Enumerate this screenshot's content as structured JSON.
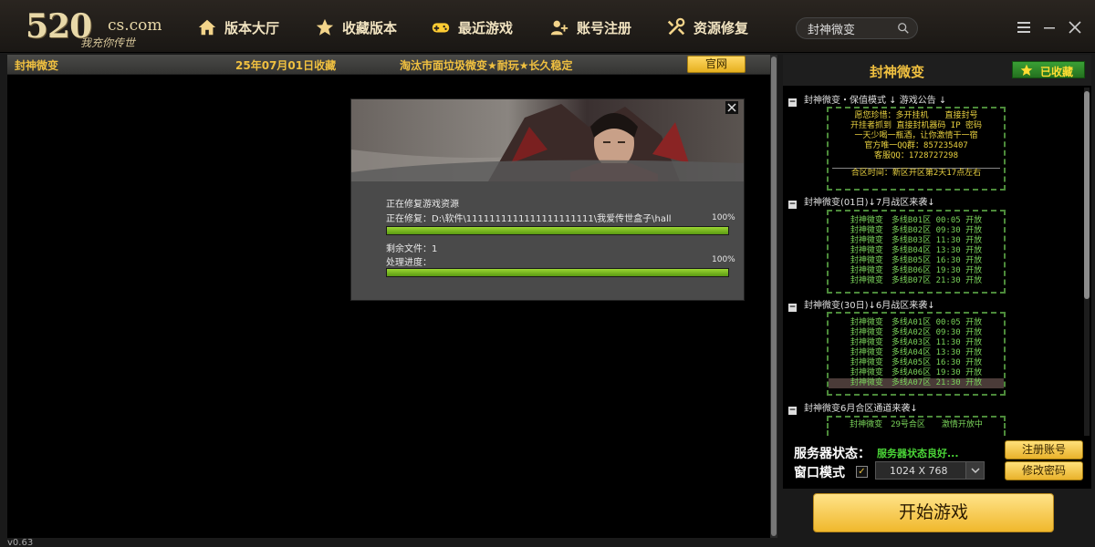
{
  "header": {
    "logo": {
      "big": "520",
      "com": "cs.com",
      "slogan": "我充你传世"
    },
    "nav": [
      {
        "label": "版本大厅",
        "icon": "home-icon"
      },
      {
        "label": "收藏版本",
        "icon": "star-icon"
      },
      {
        "label": "最近游戏",
        "icon": "gamepad-icon"
      },
      {
        "label": "账号注册",
        "icon": "user-add-icon"
      },
      {
        "label": "资源修复",
        "icon": "tools-icon"
      }
    ],
    "search_value": "封神微变"
  },
  "infobar": {
    "name": "封神微变",
    "date": "25年07月01日收藏",
    "desc": "淘汰市面垃圾微变★耐玩★长久稳定",
    "official_btn": "官网"
  },
  "dialog": {
    "status_title": "正在修复游戏资源",
    "path_label": "正在修复：D:\\软件\\1111111111111111111111\\我爱传世盒子\\hall",
    "pct1": "100%",
    "remaining_label": "剩余文件：1",
    "progress_label": "处理进度：",
    "pct2": "100%",
    "bar1": 1.0,
    "bar2": 1.0
  },
  "right": {
    "title": "封神微变",
    "fav_label": "已收藏",
    "sections": [
      {
        "title": "封神微变・保值模式 ↓ 游戏公告 ↓",
        "lines": [
          "愿您珍惜：多开挂机　　直接封号",
          "开挂者抓到 直接封机器码 IP 密码",
          "一天少喝一瓶酒，让你激情干一宿",
          "官方唯一QQ群：857235407",
          "客服QQ：1728727298",
          "",
          "合区时间：新区开区第2天17点左右"
        ]
      },
      {
        "title": "封神微变(01日)↓7月战区来袭↓",
        "lines": [
          "封神微变　多线B01区 00:05 开放",
          "封神微变　多线B02区 09:30 开放",
          "封神微变　多线B03区 11:30 开放",
          "封神微变　多线B04区 13:30 开放",
          "封神微变　多线B05区 16:30 开放",
          "封神微变　多线B06区 19:30 开放",
          "封神微变　多线B07区 21:30 开放"
        ]
      },
      {
        "title": "封神微变(30日)↓6月战区来袭↓",
        "lines": [
          "封神微变　多线A01区 00:05 开放",
          "封神微变　多线A02区 09:30 开放",
          "封神微变　多线A03区 11:30 开放",
          "封神微变　多线A04区 13:30 开放",
          "封神微变　多线A05区 16:30 开放",
          "封神微变　多线A06区 19:30 开放",
          "封神微变　多线A07区 21:30 开放"
        ]
      },
      {
        "title": "封神微变6月合区通道来袭↓",
        "lines": [
          "封神微变　29号合区　　激情开放中"
        ]
      }
    ]
  },
  "status": {
    "server_label": "服务器状态：",
    "server_value": "服务器状态良好...",
    "window_label": "窗口模式",
    "window_checked": "✓",
    "resolution": "1024 X 768",
    "register_btn": "注册账号",
    "password_btn": "修改密码"
  },
  "start_btn": "开始游戏",
  "version": "v0.63"
}
